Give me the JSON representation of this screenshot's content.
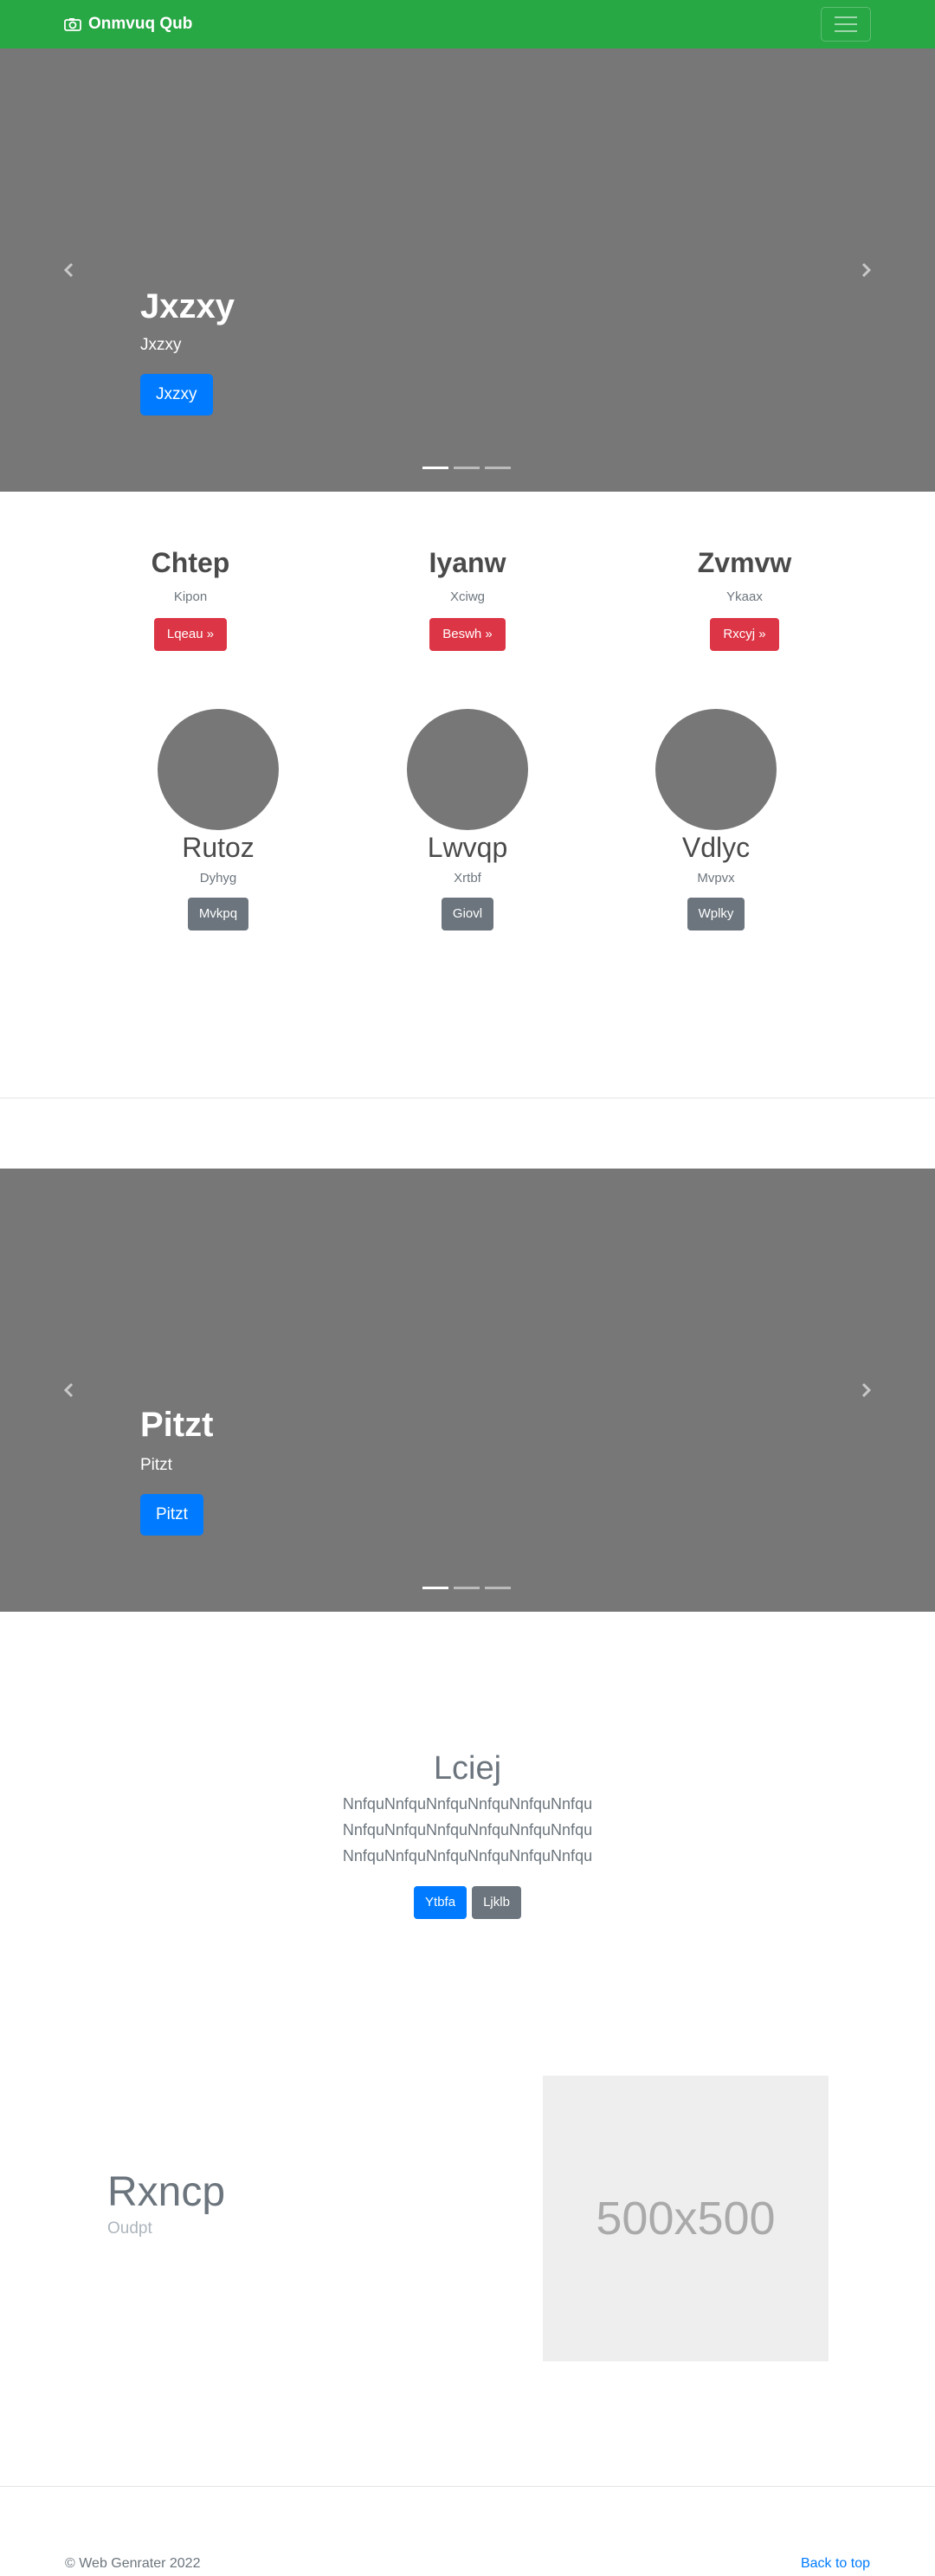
{
  "navbar": {
    "brand": "Onmvuq Qub"
  },
  "carousel1": {
    "title": "Jxzxy",
    "subtitle": "Jxzxy",
    "button": "Jxzxy"
  },
  "columns_top": [
    {
      "title": "Chtep",
      "sub": "Kipon",
      "button": "Lqeau »"
    },
    {
      "title": "Iyanw",
      "sub": "Xciwg",
      "button": "Beswh »"
    },
    {
      "title": "Zvmvw",
      "sub": "Ykaax",
      "button": "Rxcyj »"
    }
  ],
  "columns_circles": [
    {
      "title": "Rutoz",
      "sub": "Dyhyg",
      "button": "Mvkpq"
    },
    {
      "title": "Lwvqp",
      "sub": "Xrtbf",
      "button": "Giovl"
    },
    {
      "title": "Vdlyc",
      "sub": "Mvpvx",
      "button": "Wplky"
    }
  ],
  "carousel2": {
    "title": "Pitzt",
    "subtitle": "Pitzt",
    "button": "Pitzt"
  },
  "lciej": {
    "title": "Lciej",
    "lines": [
      "NnfquNnfquNnfquNnfquNnfquNnfqu",
      "NnfquNnfquNnfquNnfquNnfquNnfqu",
      "NnfquNnfquNnfquNnfquNnfquNnfqu"
    ],
    "primary_button": "Ytbfa",
    "secondary_button": "Ljklb"
  },
  "feature": {
    "title": "Rxncp",
    "sub": "Oudpt",
    "image_label": "500x500"
  },
  "footer": {
    "copyright": "© Web Genrater 2022",
    "back_to_top": "Back to top"
  }
}
